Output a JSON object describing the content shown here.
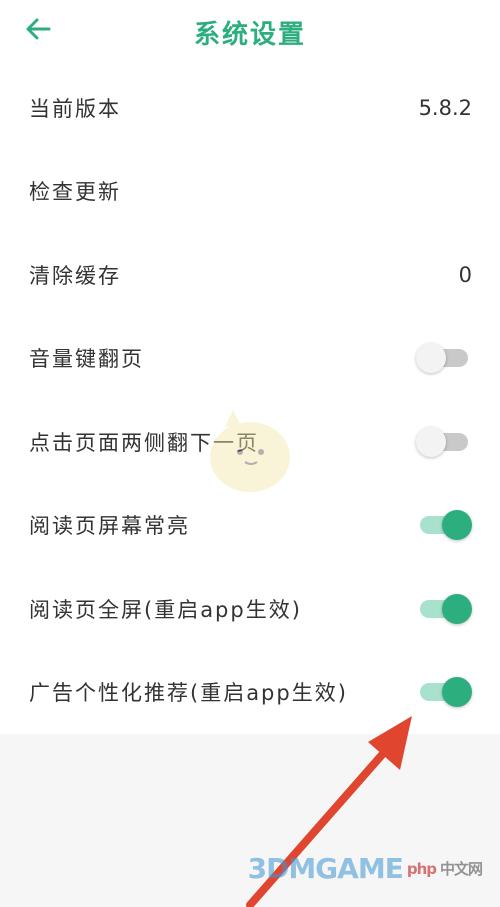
{
  "header": {
    "title": "系统设置",
    "back_icon": "arrow-left-icon",
    "accent_color": "#2dae7e"
  },
  "settings": [
    {
      "label": "当前版本",
      "value": "5.8.2"
    },
    {
      "label": "检查更新"
    },
    {
      "label": "清除缓存",
      "value": "0"
    },
    {
      "label": "音量键翻页",
      "toggle": false
    },
    {
      "label": "点击页面两侧翻下一页",
      "toggle": false
    },
    {
      "label": "阅读页屏幕常亮",
      "toggle": true
    },
    {
      "label": "阅读页全屏(重启app生效)",
      "toggle": true
    },
    {
      "label": "广告个性化推荐(重启app生效)",
      "toggle": true
    }
  ],
  "watermark": {
    "site": "3DMGAME",
    "small_left": "php",
    "small_right": "中文网"
  }
}
